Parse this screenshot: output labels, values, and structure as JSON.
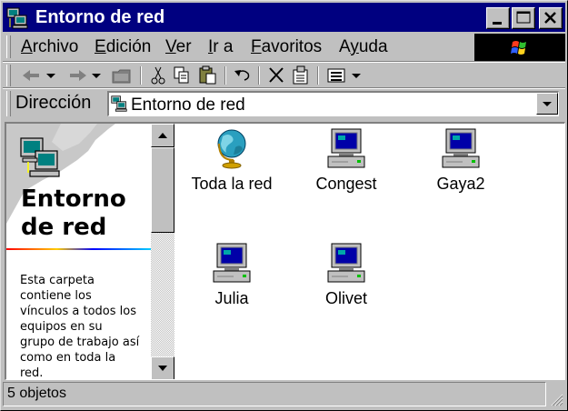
{
  "window": {
    "title": "Entorno de red",
    "icon": "network-neighborhood-icon"
  },
  "menu": {
    "items": [
      {
        "label": "Archivo",
        "accel": "A"
      },
      {
        "label": "Edición",
        "accel": "E"
      },
      {
        "label": "Ver",
        "accel": "V"
      },
      {
        "label": "Ir a",
        "accel": "I"
      },
      {
        "label": "Favoritos",
        "accel": "F"
      },
      {
        "label": "Ayuda",
        "accel": "y"
      }
    ]
  },
  "address": {
    "label": "Dirección",
    "value": "Entorno de red"
  },
  "left_pane": {
    "title": "Entorno de red",
    "description": "Esta carpeta contiene los vínculos a todos los equipos en su grupo de trabajo así como en toda la red."
  },
  "items": [
    {
      "label": "Toda la red",
      "icon": "globe-icon"
    },
    {
      "label": "Congest",
      "icon": "computer-icon"
    },
    {
      "label": "Gaya2",
      "icon": "computer-icon"
    },
    {
      "label": "Julia",
      "icon": "computer-icon"
    },
    {
      "label": "Olivet",
      "icon": "computer-icon"
    }
  ],
  "status": {
    "text": "5 objetos"
  },
  "colors": {
    "titlebar": "#000080",
    "face": "#c0c0c0"
  }
}
